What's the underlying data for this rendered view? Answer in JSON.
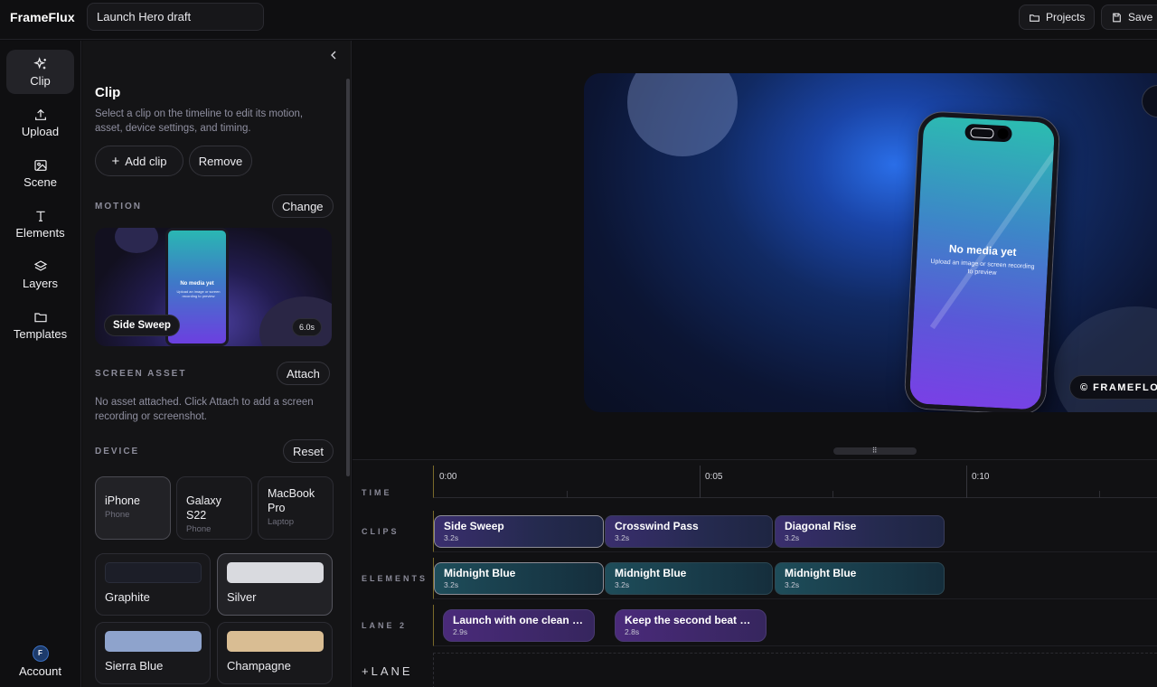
{
  "app": {
    "brand": "FrameFlux",
    "project_title": "Launch Hero draft",
    "projects_label": "Projects",
    "save_label": "Save"
  },
  "rail": {
    "items": [
      {
        "label": "Clip",
        "icon": "sparkles-icon"
      },
      {
        "label": "Upload",
        "icon": "upload-icon"
      },
      {
        "label": "Scene",
        "icon": "image-icon"
      },
      {
        "label": "Elements",
        "icon": "text-icon"
      },
      {
        "label": "Layers",
        "icon": "layers-icon"
      },
      {
        "label": "Templates",
        "icon": "folder-icon"
      }
    ],
    "account_label": "Account",
    "account_initial": "F"
  },
  "panel": {
    "title": "Clip",
    "description": "Select a clip on the timeline to edit its motion, asset, device settings, and timing.",
    "add_clip_label": "Add clip",
    "remove_label": "Remove",
    "motion": {
      "label": "MOTION",
      "change_label": "Change",
      "preview_name": "Side Sweep",
      "preview_duration": "6.0s",
      "mini_title": "No media yet",
      "mini_sub": "Upload an image or screen recording to preview"
    },
    "screen_asset": {
      "label": "SCREEN ASSET",
      "attach_label": "Attach",
      "description": "No asset attached. Click Attach to add a screen recording or screenshot."
    },
    "device": {
      "label": "DEVICE",
      "reset_label": "Reset",
      "options": [
        {
          "name": "iPhone",
          "type": "Phone"
        },
        {
          "name": "Galaxy S22",
          "type": "Phone"
        },
        {
          "name": "MacBook Pro",
          "type": "Laptop"
        }
      ],
      "colors": [
        {
          "name": "Graphite",
          "hex": "#1c1e28"
        },
        {
          "name": "Silver",
          "hex": "#d9dadf"
        },
        {
          "name": "Sierra Blue",
          "hex": "#8ea3cc"
        },
        {
          "name": "Champagne",
          "hex": "#d9bd93"
        }
      ]
    }
  },
  "preview": {
    "title": "No media yet",
    "subtitle": "Upload an image or screen recording to preview",
    "watermark": "© FRAMEFLOW"
  },
  "timeline": {
    "labels": {
      "time": "TIME",
      "clips": "CLIPS",
      "elements": "ELEMENTS",
      "lane2": "LANE 2",
      "add_lane": "+LANE"
    },
    "ticks": [
      "0:00",
      "0:05",
      "0:10"
    ],
    "clips": [
      {
        "name": "Side Sweep",
        "duration": "3.2s"
      },
      {
        "name": "Crosswind Pass",
        "duration": "3.2s"
      },
      {
        "name": "Diagonal Rise",
        "duration": "3.2s"
      }
    ],
    "elements": [
      {
        "name": "Midnight Blue",
        "duration": "3.2s"
      },
      {
        "name": "Midnight Blue",
        "duration": "3.2s"
      },
      {
        "name": "Midnight Blue",
        "duration": "3.2s"
      }
    ],
    "lane2": [
      {
        "name": "Launch with one clean h...",
        "duration": "2.9s"
      },
      {
        "name": "Keep the second beat al...",
        "duration": "2.8s"
      }
    ]
  }
}
